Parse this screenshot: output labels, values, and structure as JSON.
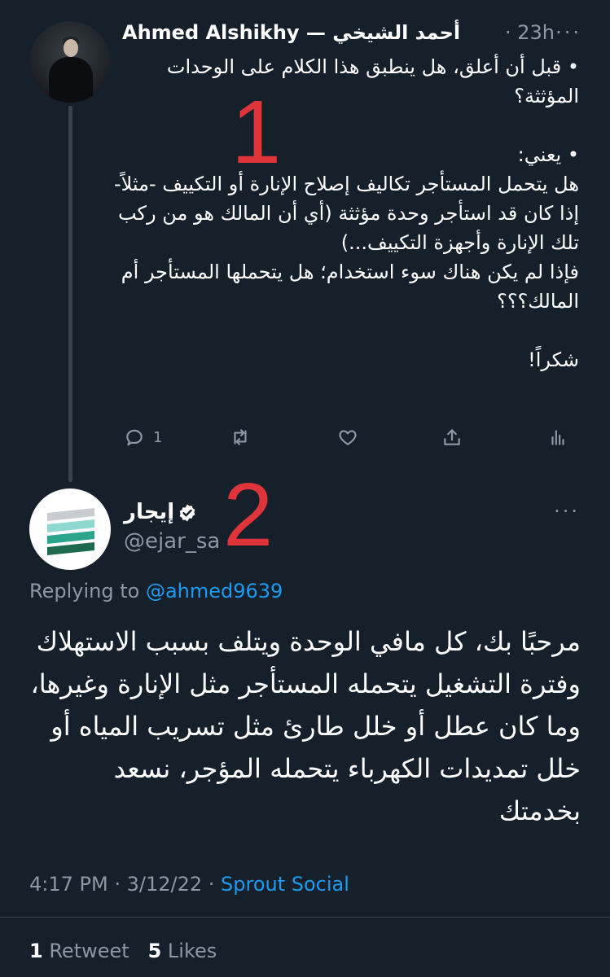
{
  "tweet1": {
    "author_name": "Ahmed Alshikhy — أحمد الشيخي",
    "time": "· 23h",
    "more": "···",
    "body": "• قبل أن أعلق، هل ينطبق هذا الكلام على الوحدات المؤثثة؟\n\n• يعني:\nهل يتحمل المستأجر تكاليف إصلاح الإنارة أو التكييف -مثلاً- إذا كان قد استأجر وحدة مؤثثة (أي أن المالك هو من ركب تلك الإنارة وأجهزة التكييف...)\nفإذا لم يكن هناك سوء استخدام؛ هل يتحملها المستأجر أم المالك؟؟؟\n\nشكراً!",
    "reply_count": "1",
    "icons": [
      "reply-icon",
      "retweet-icon",
      "like-icon",
      "share-icon",
      "analytics-icon"
    ]
  },
  "annotations": {
    "first": "1",
    "second": "2"
  },
  "tweet2": {
    "author_name": "إيجار",
    "handle": "@ejar_sa",
    "more": "···",
    "replying_prefix": "Replying to ",
    "replying_to": "@ahmed9639",
    "body": "مرحبًا بك، كل مافي الوحدة ويتلف بسبب الاستهلاك وفترة التشغيل يتحمله المستأجر مثل الإنارة وغيرها، وما كان عطل أو خلل طارئ مثل تسريب المياه أو خلل تمديدات الكهرباء يتحمله المؤجر، نسعد بخدمتك",
    "time": "4:17 PM",
    "date": "3/12/22",
    "sep": " · ",
    "source": "Sprout Social",
    "retweets": "1",
    "retweets_label": " Retweet",
    "likes": "5",
    "likes_label": " Likes"
  },
  "colors": {
    "background": "#15202b",
    "muted": "#8b98a5",
    "link": "#1d9bf0",
    "annotation": "#e0343b"
  }
}
